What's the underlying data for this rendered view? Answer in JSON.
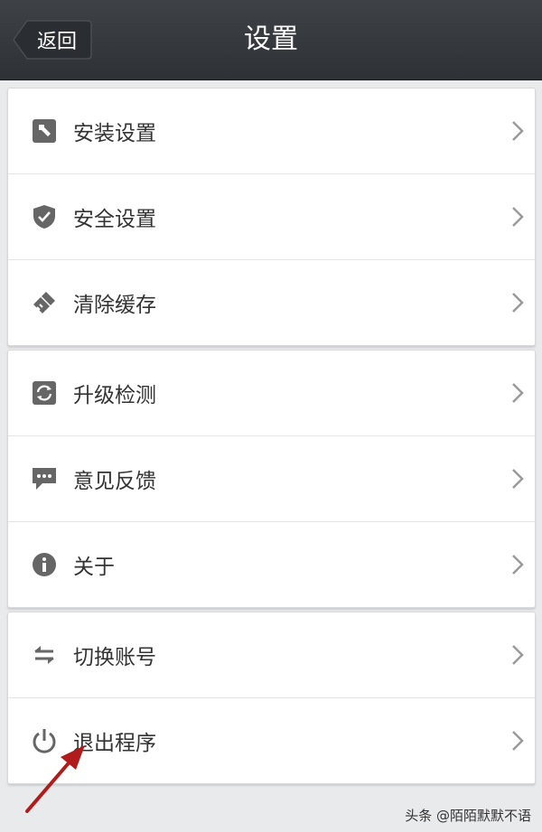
{
  "header": {
    "back_label": "返回",
    "title": "设置"
  },
  "groups": [
    {
      "items": [
        {
          "label": "安装设置",
          "icon": "hammer-icon"
        },
        {
          "label": "安全设置",
          "icon": "shield-icon"
        },
        {
          "label": "清除缓存",
          "icon": "brush-icon"
        }
      ]
    },
    {
      "items": [
        {
          "label": "升级检测",
          "icon": "refresh-icon"
        },
        {
          "label": "意见反馈",
          "icon": "chat-icon"
        },
        {
          "label": "关于",
          "icon": "info-icon"
        }
      ]
    },
    {
      "items": [
        {
          "label": "切换账号",
          "icon": "switch-icon"
        },
        {
          "label": "退出程序",
          "icon": "power-icon"
        }
      ]
    }
  ],
  "watermark": "头条 @陌陌默默不语",
  "colors": {
    "header": "#33373b",
    "background": "#e9eaec",
    "icon": "#666666",
    "annotation_arrow": "#b01c1c"
  }
}
